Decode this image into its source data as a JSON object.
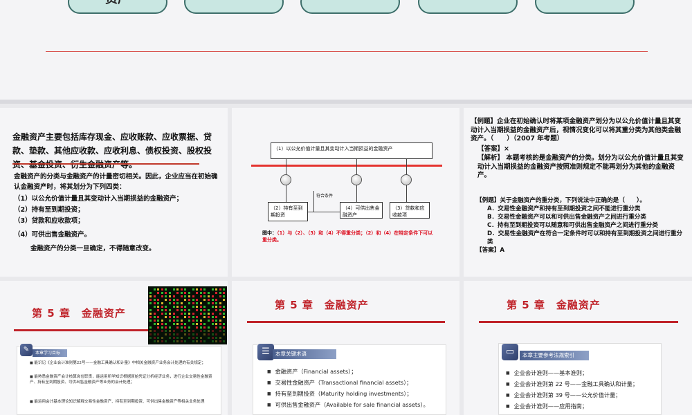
{
  "top_slide": {
    "pills": [
      "资产",
      "",
      "",
      "",
      ""
    ]
  },
  "slide1": {
    "lead": "金融资产主要包括库存现金、应收账款、应收票据、贷款、垫款、其他应收款、应收利息、债权投资、股权投资、基金投资、衍生金融资产等。",
    "p1": "金融资产的分类与金融资产的计量密切相关。因此，企业应当在初始确认金融资产时，将其划分为下列四类：",
    "items": [
      "（1）以公允价值计量且其变动计入当期损益的金融资产；",
      "（2）持有至到期投资；",
      "（3）贷款和应收款项；",
      "（4）可供出售金融资产。"
    ],
    "p2": "金融资产的分类一旦确定，不得随意改变。"
  },
  "slide2": {
    "top_box": "（1）以公允价值计量且其变动计入当期损益的金融资产",
    "mid_label": "符合条件",
    "box2": "（2）持有至到期投资",
    "box4": "（4）可供出售金融资产",
    "box3": "（3）贷款和应收款项",
    "note_prefix": "图中：",
    "note": "（1）与（2）、（3）和（4）不得重分类；（2）和（4）在特定条件下可以重分类。"
  },
  "slide3": {
    "q1": "【例题】企业在初始确认时将某项金融资产划分为以公允价值计量且其变动计入当期损益的金融资产后，视情况变化可以将其重分类为其他类金融资产。（　　）（2007 年考题）",
    "a1": "【答案】×",
    "e1": "【解析】 本题考核的是金融资产的分类。划分为以公允价值计量且其变动计入当期损益的金融资产按照准则规定不能再划分为其他的金融资产。",
    "q2": "【例题】关于金融资产的重分类，下列说法中正确的是（　　）。",
    "options": [
      "A．交易性金融资产和持有至到期投资之间不能进行重分类",
      "B．交易性金融资产可以和可供出售金融资产之间进行重分类",
      "C．持有至到期投资可以随意和可供出售金融资产之间进行重分类",
      "D．交易性金融资产在符合一定条件时可以和持有至到期投资之间进行重分类"
    ],
    "a2": "【答案】A"
  },
  "slide4": {
    "chapter": "第 5 章　金融资产",
    "panel_title": "本章学习目标",
    "items": [
      "能识记《企业会计准则第22号——金融工具确认和计量》中相关金融资产业务会计处理的有关规定；",
      "能熟悉金融资产会计核算岗位职责，能运用所学知识根据原始凭证分析经济业务，进行企业交易性金融资产、持有至到期投资、可供出售金融资产等业务的会计处理；",
      "能运用会计基本理论知识解释交易性金融资产、持有至到期投资、可供出售金融资产等相关业务处理"
    ]
  },
  "slide5": {
    "chapter": "第 5 章　金融资产",
    "panel_title": "本章关键术语",
    "items": [
      "金融资产（Financial assets）；",
      "交易性金融资产（Transactional financial assets）；",
      "持有至到期投资（Maturity holding investments）；",
      "可供出售金融资产（Available for sale financial assets）。"
    ]
  },
  "slide6": {
    "chapter": "第 5 章　金融资产",
    "panel_title": "本章主要参考法规索引",
    "items": [
      "企业会计准则——基本准则；",
      "企业会计准则第 22 号——金融工具确认和计量；",
      "企业会计准则第 39 号——公允价值计量；",
      "企业会计准则——应用指南；"
    ]
  },
  "colors": {
    "accent_red": "#c0232a",
    "panel_blue": "#4a5f8e"
  }
}
